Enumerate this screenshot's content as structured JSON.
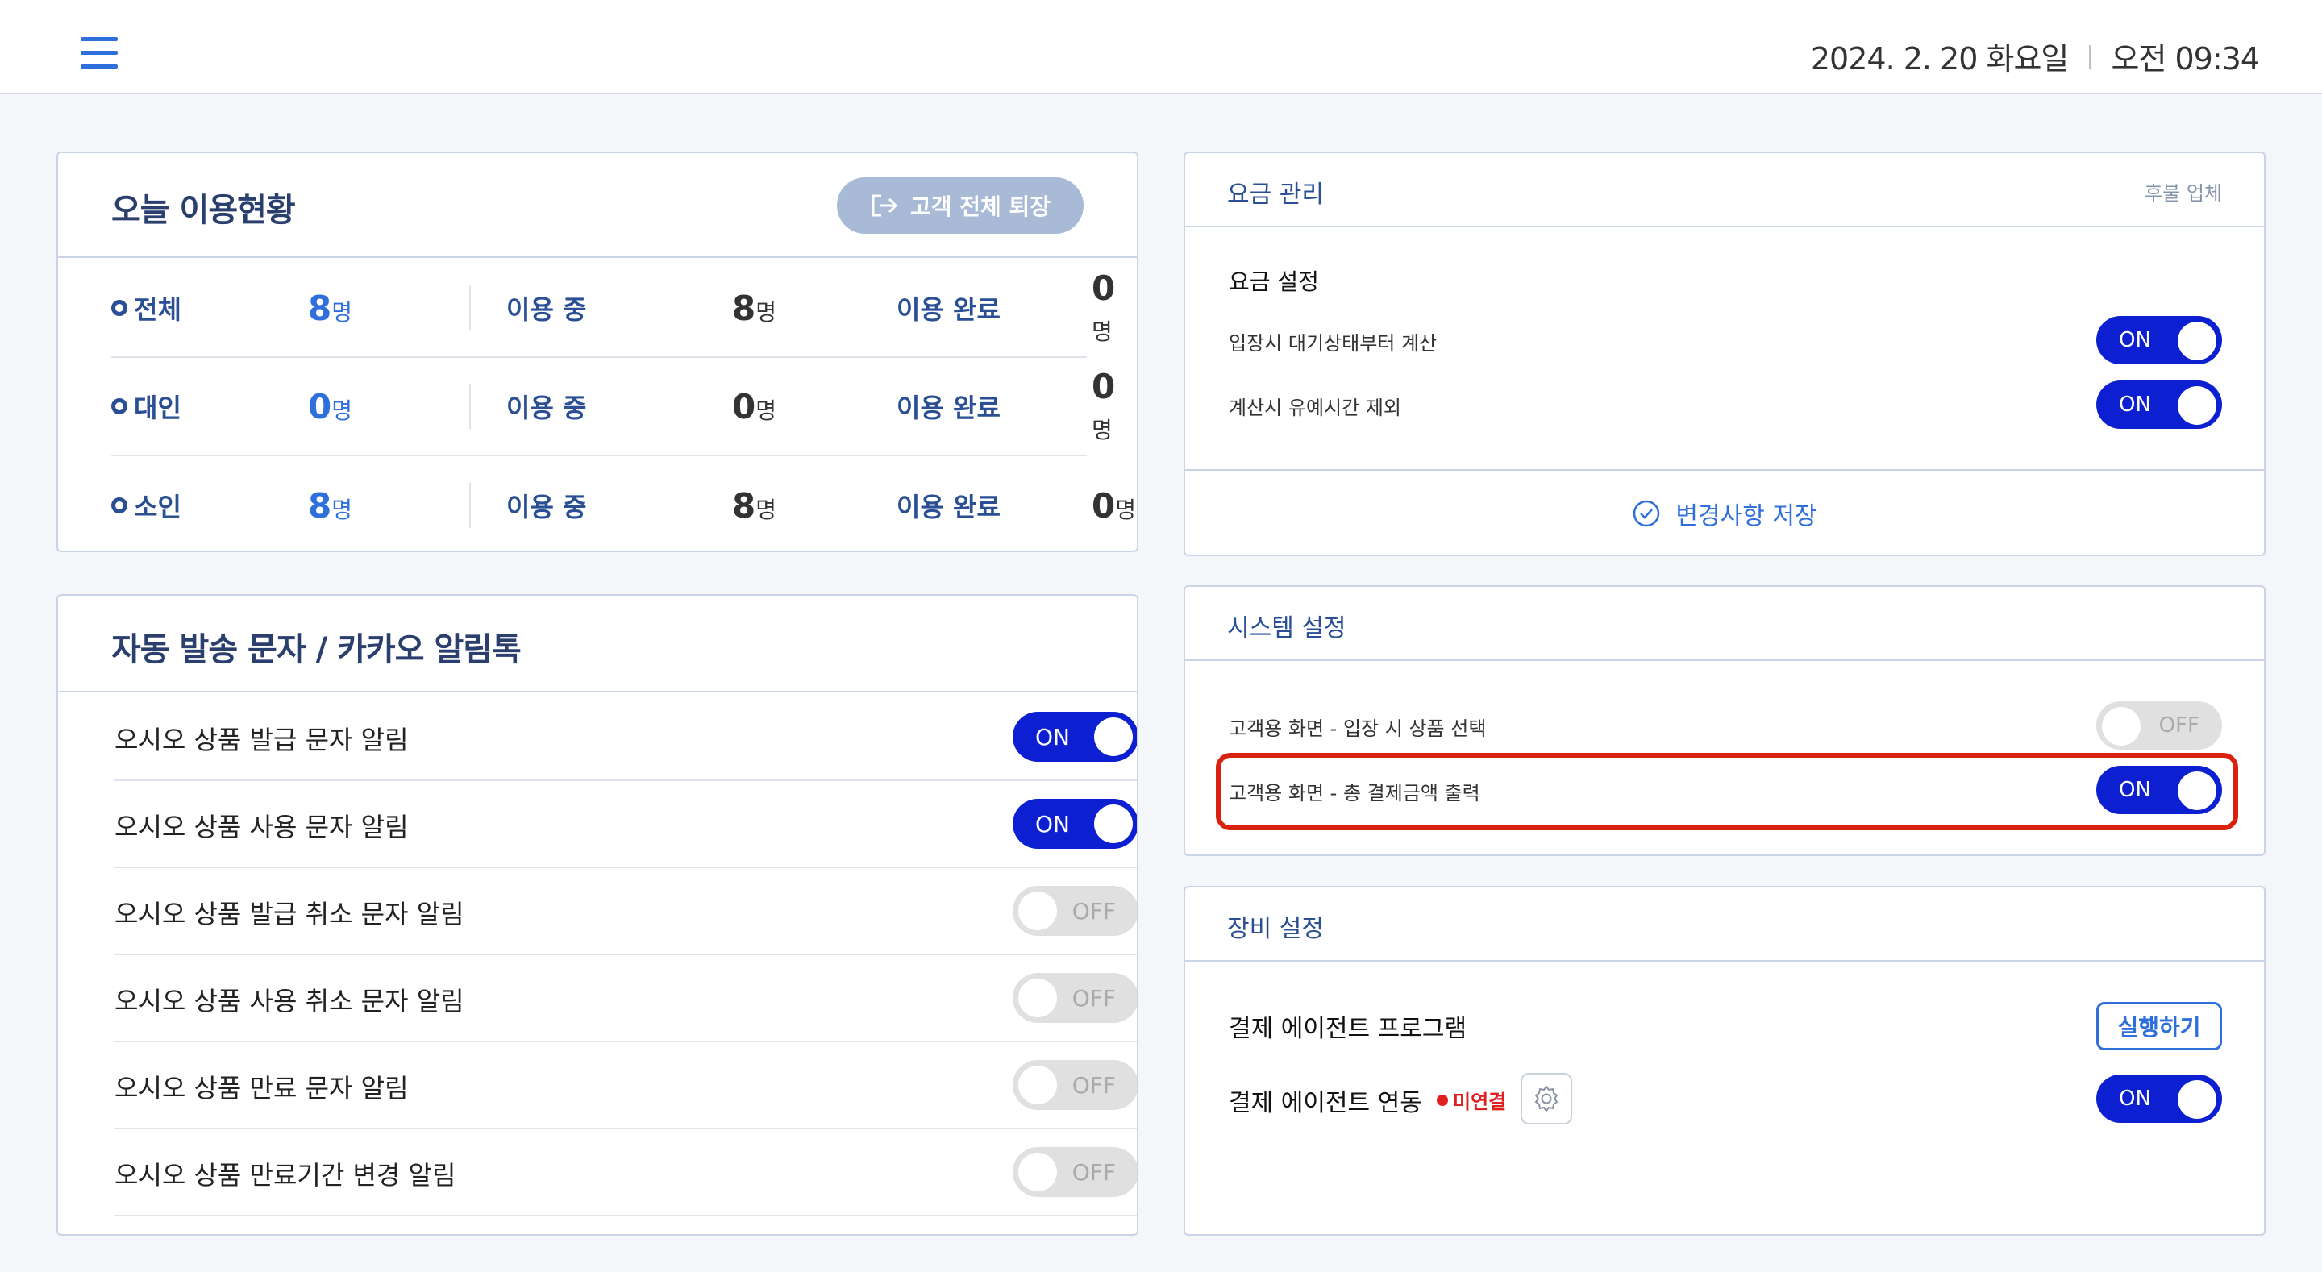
{
  "header": {
    "date": "2024. 2. 20 화요일",
    "separator": "|",
    "time": "오전 09:34"
  },
  "usage": {
    "title": "오늘 이용현황",
    "checkout_button": "고객 전체 퇴장",
    "in_use_label": "이용 중",
    "done_label": "이용 완료",
    "unit": "명",
    "rows": [
      {
        "label": "전체",
        "total": "8",
        "in_use": "8",
        "done": "0"
      },
      {
        "label": "대인",
        "total": "0",
        "in_use": "0",
        "done": "0"
      },
      {
        "label": "소인",
        "total": "8",
        "in_use": "8",
        "done": "0"
      }
    ]
  },
  "sms": {
    "title": "자동 발송 문자 / 카카오 알림톡",
    "items": [
      {
        "label": "오시오 상품 발급 문자 알림",
        "state": "ON"
      },
      {
        "label": "오시오 상품 사용 문자 알림",
        "state": "ON"
      },
      {
        "label": "오시오 상품 발급 취소 문자 알림",
        "state": "OFF"
      },
      {
        "label": "오시오 상품 사용 취소 문자 알림",
        "state": "OFF"
      },
      {
        "label": "오시오 상품 만료 문자 알림",
        "state": "OFF"
      },
      {
        "label": "오시오 상품 만료기간 변경 알림",
        "state": "OFF"
      }
    ]
  },
  "fee": {
    "title": "요금 관리",
    "note": "후불 업체",
    "subtitle": "요금 설정",
    "items": [
      {
        "label": "입장시 대기상태부터 계산",
        "state": "ON"
      },
      {
        "label": "계산시 유예시간 제외",
        "state": "ON"
      }
    ],
    "save_label": "변경사항 저장"
  },
  "system": {
    "title": "시스템 설정",
    "items": [
      {
        "label": "고객용 화면 - 입장 시 상품 선택",
        "state": "OFF"
      },
      {
        "label": "고객용 화면 - 총 결제금액 출력",
        "state": "ON"
      }
    ]
  },
  "equipment": {
    "title": "장비 설정",
    "program_label": "결제 에이전트 프로그램",
    "run_button": "실행하기",
    "link_label": "결제 에이전트 연동",
    "status": "미연결",
    "link_state": "ON"
  },
  "colors": {
    "toggle_on": "#0c1fd1",
    "accent": "#2f6fdc",
    "highlight": "#d8220f",
    "status_error": "#e02020"
  }
}
